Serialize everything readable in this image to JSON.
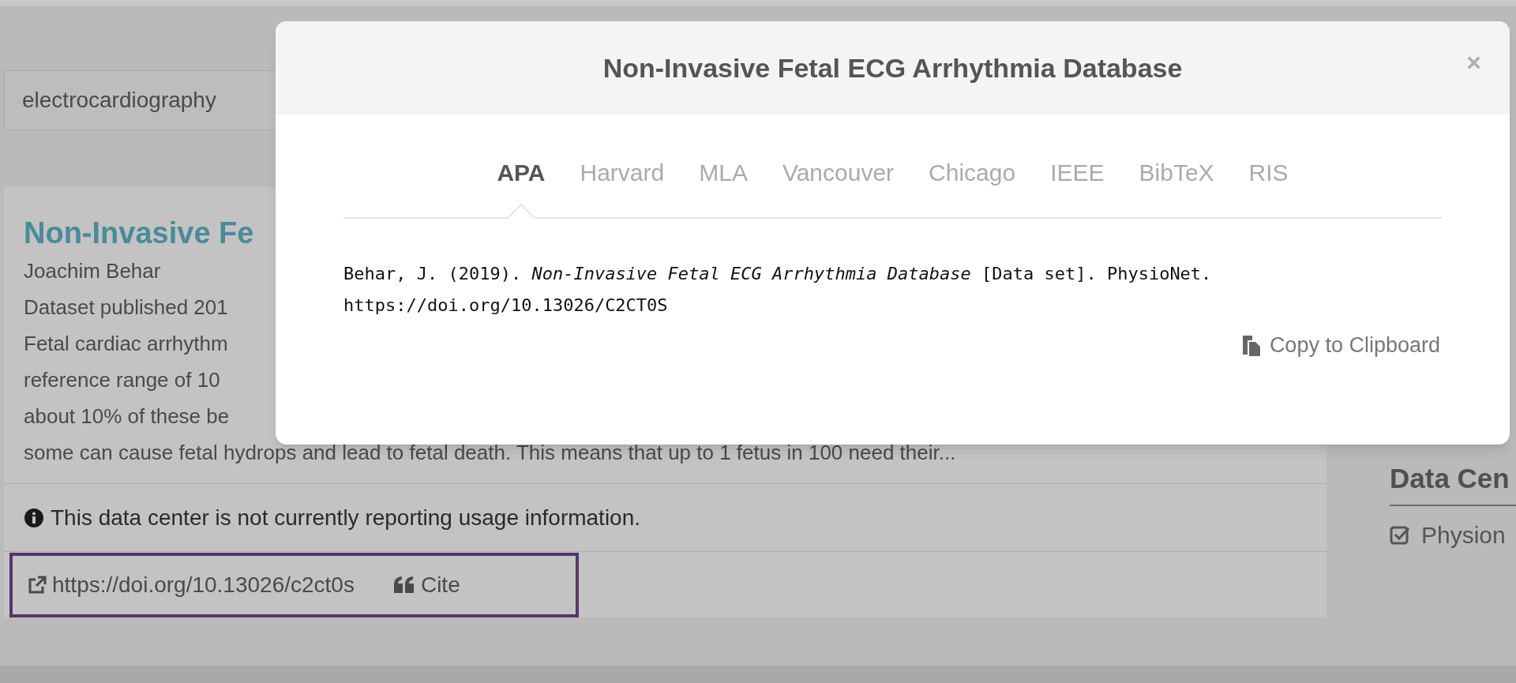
{
  "search": {
    "value": "electrocardiography"
  },
  "result": {
    "title": "Non-Invasive Fe",
    "lines": [
      "Joachim Behar",
      "Dataset published 201",
      "Fetal cardiac arrhythm",
      "reference range of 10",
      "about 10% of these be",
      "some can cause fetal hydrops and lead to fetal death. This means that up to 1 fetus in 100 need their..."
    ],
    "usage_note": "This data center is not currently reporting usage information.",
    "doi_link": "https://doi.org/10.13026/c2ct0s",
    "cite_button": "Cite"
  },
  "sidebar": {
    "heading": "Data Cen",
    "filters": [
      {
        "label": "Physion",
        "checked": true
      }
    ]
  },
  "modal": {
    "title": "Non-Invasive Fetal ECG Arrhythmia Database",
    "close": "×",
    "tabs": [
      {
        "label": "APA",
        "selected": true
      },
      {
        "label": "Harvard",
        "selected": false
      },
      {
        "label": "MLA",
        "selected": false
      },
      {
        "label": "Vancouver",
        "selected": false
      },
      {
        "label": "Chicago",
        "selected": false
      },
      {
        "label": "IEEE",
        "selected": false
      },
      {
        "label": "BibTeX",
        "selected": false
      },
      {
        "label": "RIS",
        "selected": false
      }
    ],
    "citation": "Behar, J. (2019). *Non-Invasive Fetal ECG Arrhythmia Database* [Data set]. PhysioNet. https://doi.org/10.13026/C2CT0S",
    "copy_button": "Copy to Clipboard"
  }
}
